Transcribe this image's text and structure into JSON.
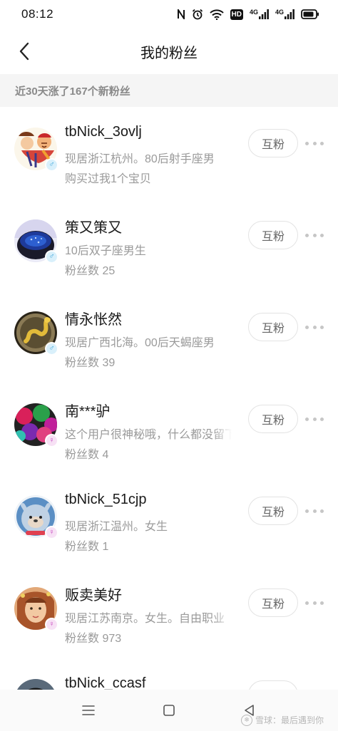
{
  "status_bar": {
    "time": "08:12",
    "icons": [
      "nfc-icon",
      "alarm-icon",
      "wifi-icon",
      "hd-icon",
      "signal-4g-icon",
      "signal-4g-icon",
      "battery-icon"
    ],
    "hd_label": "HD",
    "net_label_1": "4G",
    "net_label_2": "4G"
  },
  "header": {
    "back_icon": "chevron-left-icon",
    "title": "我的粉丝"
  },
  "summary": {
    "text": "近30天涨了167个新粉丝"
  },
  "fans": [
    {
      "name": "tbNick_3ovlj",
      "line1": "现居浙江杭州。80后射手座男",
      "line2": "购买过我1个宝贝",
      "gender": "male",
      "gender_symbol": "♂",
      "button": "互粉"
    },
    {
      "name": "策又策又",
      "line1": "10后双子座男生",
      "line2": "粉丝数 25",
      "gender": "male",
      "gender_symbol": "♂",
      "button": "互粉"
    },
    {
      "name": "情永怅然",
      "line1": "现居广西北海。00后天蝎座男",
      "line2": "粉丝数 39",
      "gender": "male",
      "gender_symbol": "♂",
      "button": "互粉"
    },
    {
      "name": "南***驴",
      "line1": "这个用户很神秘哦，什么都没留下",
      "line2": "粉丝数 4",
      "gender": "female",
      "gender_symbol": "♀",
      "button": "互粉"
    },
    {
      "name": "tbNick_51cjp",
      "line1": "现居浙江温州。女生",
      "line2": "粉丝数 1",
      "gender": "female",
      "gender_symbol": "♀",
      "button": "互粉"
    },
    {
      "name": "贩卖美好",
      "line1": "现居江苏南京。女生。自由职业",
      "line2": "粉丝数 973",
      "gender": "female",
      "gender_symbol": "♀",
      "button": "互粉"
    },
    {
      "name": "tbNick_ccasf",
      "line1": "",
      "line2": "",
      "gender": "male",
      "gender_symbol": "♂",
      "button": "互粉"
    }
  ],
  "nav_bar": {
    "icons": [
      "menu-icon",
      "home-square-icon",
      "back-triangle-icon"
    ],
    "watermark": "雪球：最后遇到你"
  }
}
